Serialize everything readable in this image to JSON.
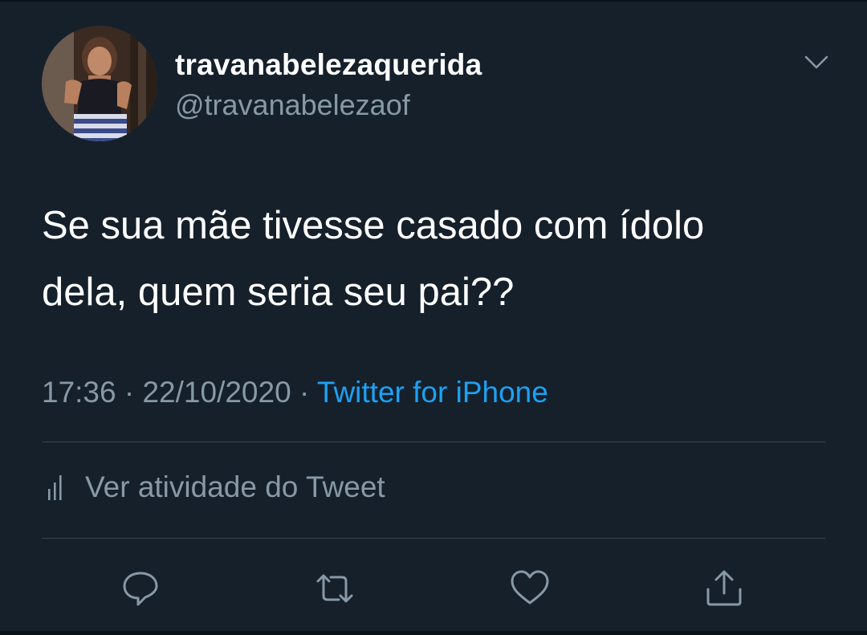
{
  "user": {
    "display_name": "travanabelezaquerida",
    "handle": "@travanabelezaof"
  },
  "tweet": {
    "text": "Se sua mãe tivesse casado com ídolo\ndela, quem seria seu pai??",
    "time": "17:36",
    "date": "22/10/2020",
    "separator": "·",
    "source": "Twitter for iPhone"
  },
  "activity": {
    "label": "Ver atividade do Tweet",
    "icon": "bar-chart-icon"
  },
  "actions": [
    {
      "name": "reply",
      "icon": "reply-icon"
    },
    {
      "name": "retweet",
      "icon": "retweet-icon"
    },
    {
      "name": "like",
      "icon": "heart-icon"
    },
    {
      "name": "share",
      "icon": "share-icon"
    }
  ],
  "colors": {
    "background": "#15202b",
    "primary_text": "#ffffff",
    "secondary_text": "#8899a6",
    "link": "#1da1f2",
    "divider": "#38444d"
  }
}
